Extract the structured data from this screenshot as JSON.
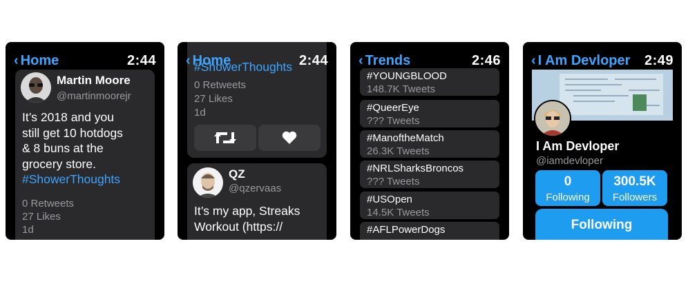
{
  "screen1": {
    "nav_back": "Home",
    "time": "2:44",
    "name": "Martin Moore",
    "handle": "@martinmoorejr",
    "tweet_lines": [
      "It’s 2018 and you",
      "still get 10 hotdogs",
      "& 8 buns at the",
      "grocery store."
    ],
    "hashtag": "#ShowerThoughts",
    "retweets": "0 Retweets",
    "likes": "27 Likes",
    "age": "1d"
  },
  "screen2": {
    "nav_back": "Home",
    "time": "2:44",
    "hashtag": "#ShowerThoughts",
    "retweets": "0 Retweets",
    "likes": "27 Likes",
    "age": "1d",
    "name": "QZ",
    "handle": "@qzervaas",
    "tweet_lines": [
      "It’s my app, Streaks",
      "Workout (https://"
    ]
  },
  "screen3": {
    "nav_back": "Trends",
    "time": "2:46",
    "trends": [
      {
        "tag": "#YOUNGBLOOD",
        "count": "148.7K Tweets"
      },
      {
        "tag": "#QueerEye",
        "count": "??? Tweets"
      },
      {
        "tag": "#ManoftheMatch",
        "count": "26.3K Tweets"
      },
      {
        "tag": "#NRLSharksBroncos",
        "count": "??? Tweets"
      },
      {
        "tag": "#USOpen",
        "count": "14.5K Tweets"
      },
      {
        "tag": "#AFLPowerDogs",
        "count": ""
      }
    ]
  },
  "screen4": {
    "nav_back": "I Am Devloper",
    "time": "2:49",
    "name": "I Am Devloper",
    "handle": "@iamdevloper",
    "following_count": "0",
    "following_label": "Following",
    "followers_count": "300.5K",
    "followers_label": "Followers",
    "follow_button": "Following"
  },
  "icons": [
    "chevron-left-icon",
    "retweet-icon",
    "heart-icon"
  ],
  "colors": {
    "accent": "#3ea5ff",
    "button_blue": "#1e9cf0",
    "card": "#2a2a2c"
  }
}
